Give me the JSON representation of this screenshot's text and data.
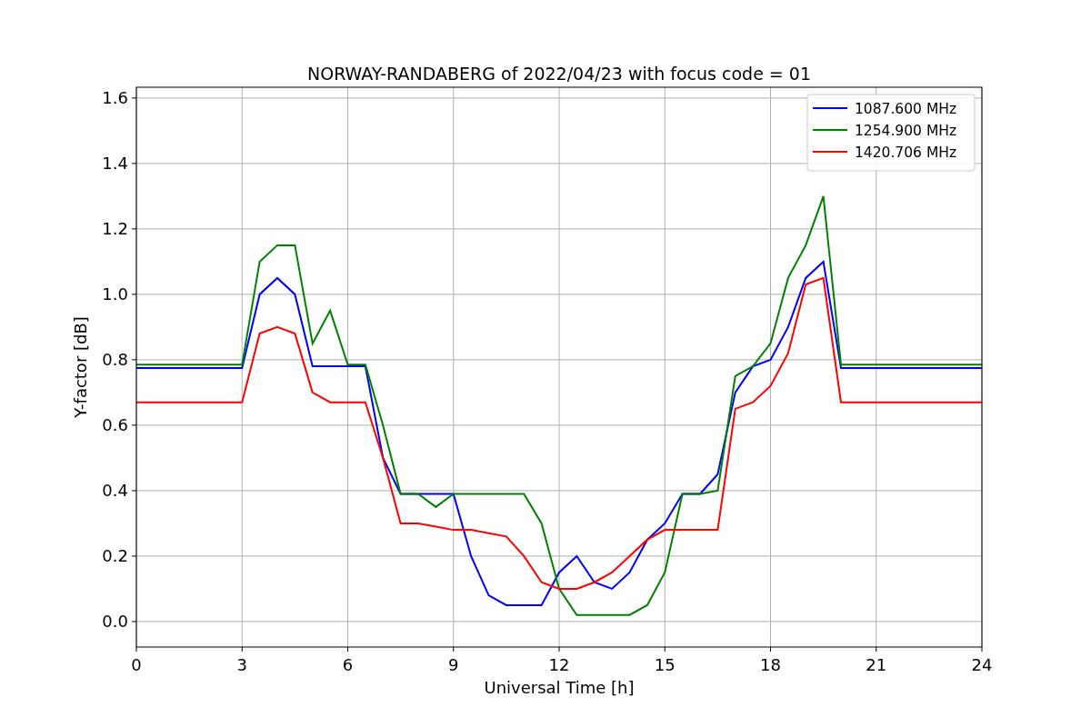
{
  "chart_data": {
    "type": "line",
    "title": "NORWAY-RANDABERG of 2022/04/23 with focus code = 01",
    "xlabel": "Universal Time [h]",
    "ylabel": "Y-factor [dB]",
    "x": [
      0,
      0.5,
      1,
      1.5,
      2,
      2.5,
      3,
      3.5,
      4,
      4.5,
      5,
      5.5,
      6,
      6.5,
      7,
      7.5,
      8,
      8.5,
      9,
      9.5,
      10,
      10.5,
      11,
      11.5,
      12,
      12.5,
      13,
      13.5,
      14,
      14.5,
      15,
      15.5,
      16,
      16.5,
      17,
      17.5,
      18,
      18.5,
      19,
      19.5,
      20,
      20.5,
      21,
      21.5,
      22,
      22.5,
      23,
      23.5,
      24
    ],
    "series": [
      {
        "name": "1087.600 MHz",
        "color": "#0000ff",
        "values": [
          0.775,
          0.775,
          0.775,
          0.775,
          0.775,
          0.775,
          0.775,
          1.0,
          1.05,
          1.0,
          0.78,
          0.78,
          0.78,
          0.78,
          0.5,
          0.39,
          0.39,
          0.39,
          0.39,
          0.2,
          0.08,
          0.05,
          0.05,
          0.05,
          0.15,
          0.2,
          0.12,
          0.1,
          0.15,
          0.25,
          0.3,
          0.39,
          0.39,
          0.45,
          0.7,
          0.78,
          0.8,
          0.9,
          1.05,
          1.1,
          0.775,
          0.775,
          0.775,
          0.775,
          0.775,
          0.775,
          0.775,
          0.775,
          0.775
        ]
      },
      {
        "name": "1254.900 MHz",
        "color": "#008000",
        "values": [
          0.785,
          0.785,
          0.785,
          0.785,
          0.785,
          0.785,
          0.785,
          1.1,
          1.15,
          1.15,
          0.85,
          0.95,
          0.785,
          0.785,
          0.6,
          0.39,
          0.39,
          0.35,
          0.39,
          0.39,
          0.39,
          0.39,
          0.39,
          0.3,
          0.1,
          0.02,
          0.02,
          0.02,
          0.02,
          0.05,
          0.15,
          0.39,
          0.39,
          0.4,
          0.75,
          0.78,
          0.85,
          1.05,
          1.15,
          1.3,
          0.785,
          0.785,
          0.785,
          0.785,
          0.785,
          0.785,
          0.785,
          0.785,
          0.785
        ]
      },
      {
        "name": "1420.706 MHz",
        "color": "#ff0000",
        "values": [
          0.67,
          0.67,
          0.67,
          0.67,
          0.67,
          0.67,
          0.67,
          0.88,
          0.9,
          0.88,
          0.7,
          0.67,
          0.67,
          0.67,
          0.5,
          0.3,
          0.3,
          0.29,
          0.28,
          0.28,
          0.27,
          0.26,
          0.2,
          0.12,
          0.1,
          0.1,
          0.12,
          0.15,
          0.2,
          0.25,
          0.28,
          0.28,
          0.28,
          0.28,
          0.65,
          0.67,
          0.72,
          0.82,
          1.03,
          1.05,
          0.67,
          0.67,
          0.67,
          0.67,
          0.67,
          0.67,
          0.67,
          0.67,
          0.67
        ]
      }
    ],
    "grid": true,
    "legend": true,
    "xlim": [
      0,
      24
    ],
    "ylim": [
      -0.078,
      1.633
    ],
    "xticks": [
      0,
      3,
      6,
      9,
      12,
      15,
      18,
      21,
      24
    ],
    "yticks": [
      {
        "value": 0,
        "label": "0.0"
      },
      {
        "value": 0.2,
        "label": "0.2"
      },
      {
        "value": 0.4,
        "label": "0.4"
      },
      {
        "value": 0.6,
        "label": "0.6"
      },
      {
        "value": 0.8,
        "label": "0.8"
      },
      {
        "value": 1.0,
        "label": "1.0"
      },
      {
        "value": 1.2,
        "label": "1.2"
      },
      {
        "value": 1.4,
        "label": "1.4"
      },
      {
        "value": 1.6,
        "label": "1.6"
      }
    ]
  }
}
